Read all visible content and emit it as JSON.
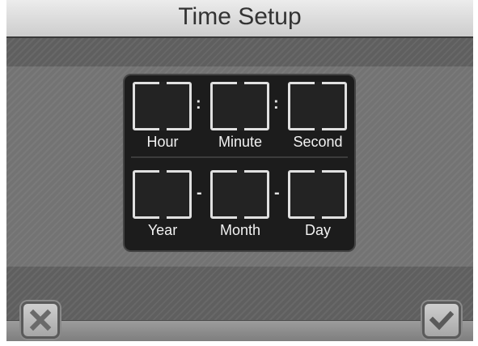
{
  "header": {
    "title": "Time Setup"
  },
  "time_fields": {
    "hour": {
      "label": "Hour",
      "value": ""
    },
    "minute": {
      "label": "Minute",
      "value": ""
    },
    "second": {
      "label": "Second",
      "value": ""
    },
    "separator": ":"
  },
  "date_fields": {
    "year": {
      "label": "Year",
      "value": ""
    },
    "month": {
      "label": "Month",
      "value": ""
    },
    "day": {
      "label": "Day",
      "value": ""
    },
    "separator": "-"
  },
  "footer": {
    "cancel_icon": "close-icon",
    "confirm_icon": "checkmark-icon"
  },
  "colors": {
    "background": "#6e6e6e",
    "panel": "#1c1c1c",
    "field_border": "#e0e0e0",
    "title_bar": "#dcdcdc"
  }
}
